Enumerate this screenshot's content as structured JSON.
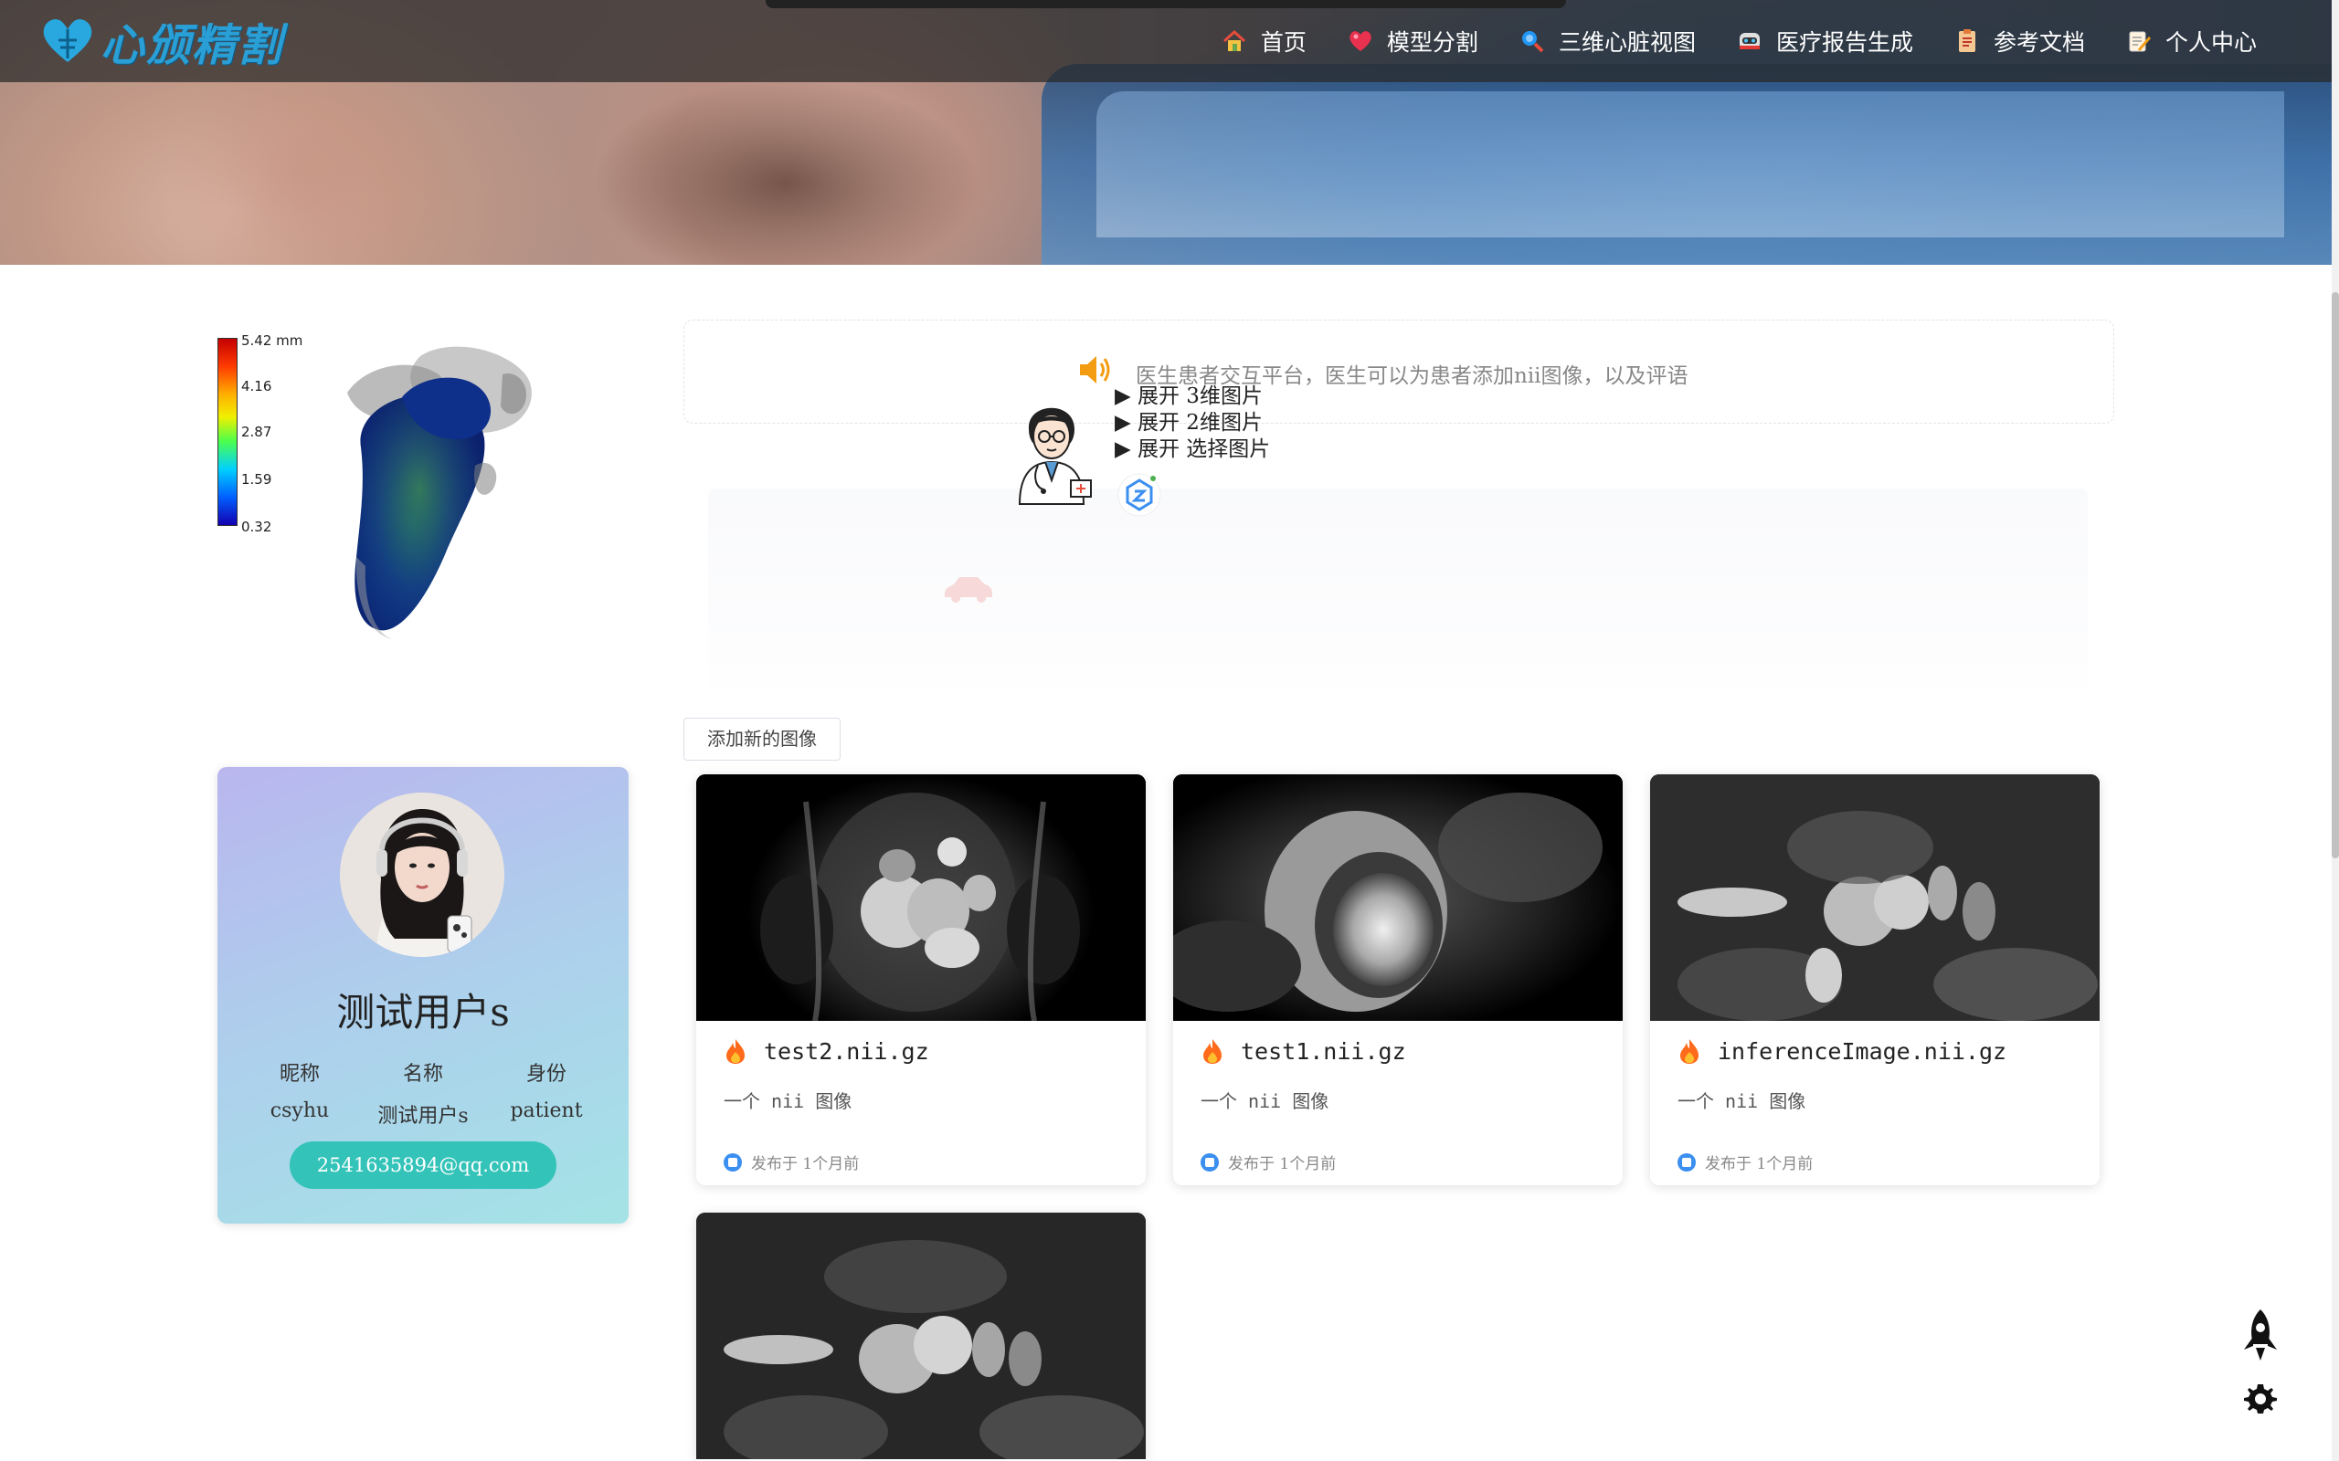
{
  "app": {
    "logo_text": "心颁精割"
  },
  "nav": {
    "items": [
      {
        "label": "首页",
        "icon": "home-icon"
      },
      {
        "label": "模型分割",
        "icon": "heart-icon"
      },
      {
        "label": "三维心脏视图",
        "icon": "magnifier-icon"
      },
      {
        "label": "医疗报告生成",
        "icon": "robot-icon"
      },
      {
        "label": "参考文档",
        "icon": "document-icon"
      },
      {
        "label": "个人中心",
        "icon": "pencil-icon"
      }
    ]
  },
  "heart_viewer": {
    "colorbar": {
      "labels": [
        "5.42 mm",
        "4.16",
        "2.87",
        "1.59",
        "0.32"
      ]
    }
  },
  "profile": {
    "name": "测试用户s",
    "fields": {
      "headers": [
        "昵称",
        "名称",
        "身份"
      ],
      "values": [
        "csyhu",
        "测试用户s",
        "patient"
      ]
    },
    "email": "2541635894@qq.com"
  },
  "notice": {
    "text": "医生患者交互平台，医生可以为患者添加nii图像，以及评语"
  },
  "expand": {
    "items": [
      "▶ 展开 3维图片",
      "▶ 展开 2维图片",
      "▶ 展开 选择图片"
    ]
  },
  "actions": {
    "add_image": "添加新的图像"
  },
  "cards": [
    {
      "title": "test2.nii.gz",
      "desc": "一个 nii 图像",
      "time": "发布于 1个月前"
    },
    {
      "title": "test1.nii.gz",
      "desc": "一个 nii 图像",
      "time": "发布于 1个月前"
    },
    {
      "title": "inferenceImage.nii.gz",
      "desc": "一个 nii 图像",
      "time": "发布于 1个月前"
    }
  ],
  "colors": {
    "accent": "#33c3b8",
    "nav_bg": "#2a2a2a",
    "notice_text": "#888888"
  }
}
